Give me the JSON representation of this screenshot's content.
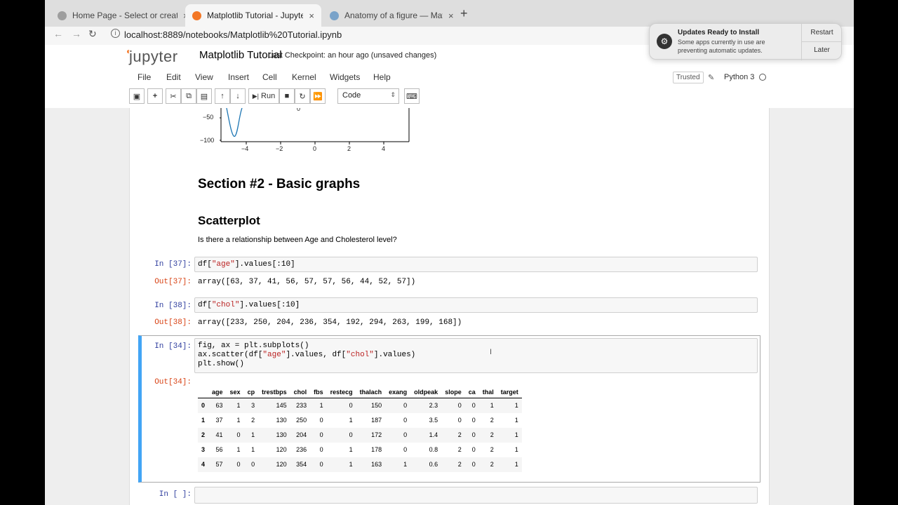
{
  "browser": {
    "tabs": [
      {
        "title": "Home Page - Select or create",
        "close": "×"
      },
      {
        "title": "Matplotlib Tutorial - Jupyter N",
        "close": "×"
      },
      {
        "title": "Anatomy of a figure — Matplot",
        "close": "×"
      }
    ],
    "new_tab": "+",
    "url": "localhost:8889/notebooks/Matplotlib%20Tutorial.ipynb"
  },
  "notification": {
    "title": "Updates Ready to Install",
    "body": "Some apps currently in use are preventing automatic updates.",
    "restart_label": "Restart",
    "later_label": "Later"
  },
  "jupyter": {
    "logo_text": "jupyter",
    "notebook_title": "Matplotlib Tutorial",
    "checkpoint": "Last Checkpoint: an hour ago  (unsaved changes)",
    "menu": [
      "File",
      "Edit",
      "View",
      "Insert",
      "Cell",
      "Kernel",
      "Widgets",
      "Help"
    ],
    "trusted": "Trusted",
    "kernel": "Python 3",
    "toolbar": {
      "run_label": "Run",
      "cell_type": "Code"
    }
  },
  "plot_fragment": {
    "y_ticks": [
      "−50",
      "−100"
    ],
    "x_ticks": [
      "−4",
      "−2",
      "0",
      "2",
      "4"
    ],
    "point_label": "0"
  },
  "markdown": {
    "section_title": "Section #2 - Basic graphs",
    "subsection_title": "Scatterplot",
    "question": "Is there a relationship between Age and Cholesterol level?"
  },
  "cells": [
    {
      "in_prompt": "In [37]:",
      "code_pre": "df[",
      "code_str": "\"age\"",
      "code_post": "].values[:10]",
      "out_prompt": "Out[37]:",
      "output": "array([63, 37, 41, 56, 57, 57, 56, 44, 52, 57])"
    },
    {
      "in_prompt": "In [38]:",
      "code_pre": "df[",
      "code_str": "\"chol\"",
      "code_post": "].values[:10]",
      "out_prompt": "Out[38]:",
      "output": "array([233, 250, 204, 236, 354, 192, 294, 263, 199, 168])"
    },
    {
      "in_prompt": "In [34]:",
      "line1": "fig, ax = plt.subplots()",
      "line2_pre": "ax.scatter(df[",
      "line2_str1": "\"age\"",
      "line2_mid": "].values, df[",
      "line2_str2": "\"chol\"",
      "line2_post": "].values)",
      "line3": "plt.show()",
      "out_prompt": "Out[34]:"
    },
    {
      "in_prompt": "In [ ]:"
    }
  ],
  "dataframe": {
    "columns": [
      "",
      "age",
      "sex",
      "cp",
      "trestbps",
      "chol",
      "fbs",
      "restecg",
      "thalach",
      "exang",
      "oldpeak",
      "slope",
      "ca",
      "thal",
      "target"
    ],
    "rows": [
      [
        "0",
        "63",
        "1",
        "3",
        "145",
        "233",
        "1",
        "0",
        "150",
        "0",
        "2.3",
        "0",
        "0",
        "1",
        "1"
      ],
      [
        "1",
        "37",
        "1",
        "2",
        "130",
        "250",
        "0",
        "1",
        "187",
        "0",
        "3.5",
        "0",
        "0",
        "2",
        "1"
      ],
      [
        "2",
        "41",
        "0",
        "1",
        "130",
        "204",
        "0",
        "0",
        "172",
        "0",
        "1.4",
        "2",
        "0",
        "2",
        "1"
      ],
      [
        "3",
        "56",
        "1",
        "1",
        "120",
        "236",
        "0",
        "1",
        "178",
        "0",
        "0.8",
        "2",
        "0",
        "2",
        "1"
      ],
      [
        "4",
        "57",
        "0",
        "0",
        "120",
        "354",
        "0",
        "1",
        "163",
        "1",
        "0.6",
        "2",
        "0",
        "2",
        "1"
      ]
    ]
  }
}
